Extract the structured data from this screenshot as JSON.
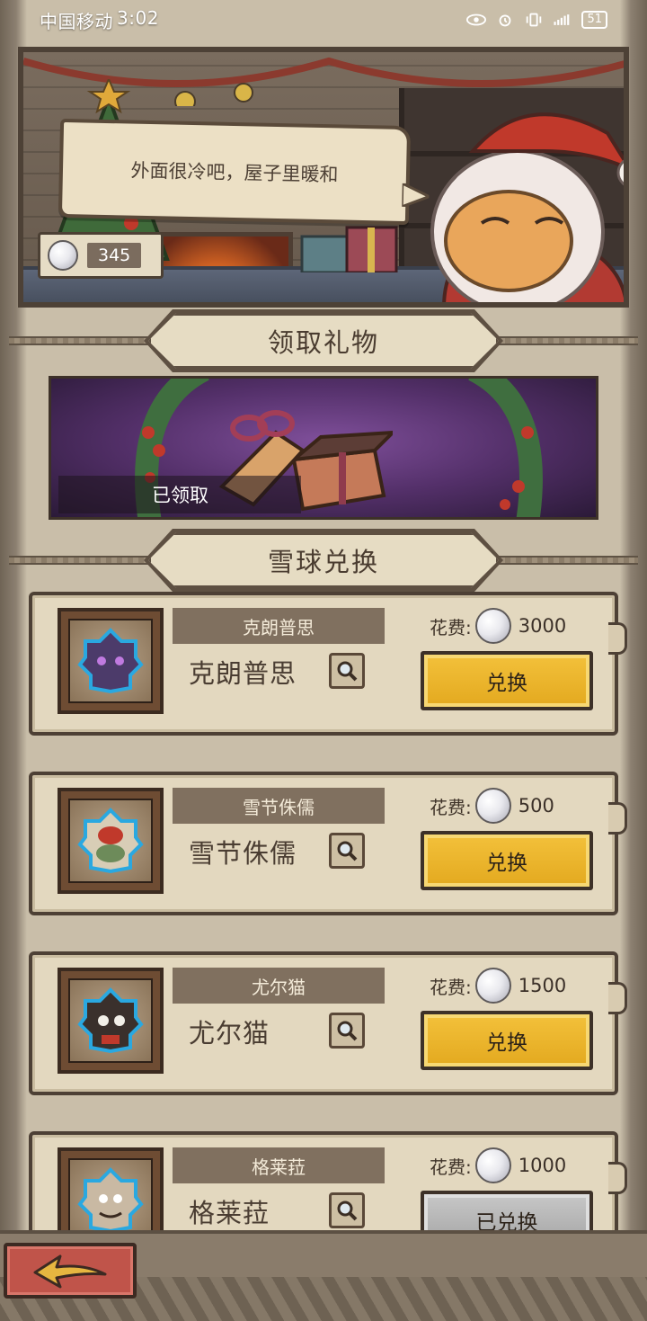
{
  "status_bar": {
    "carrier": "中国移动",
    "time": "3:02",
    "battery": "51"
  },
  "scene": {
    "speech": "外面很冷吧，屋子里暖和",
    "snowball_count": "345"
  },
  "sections": {
    "gift_title": "领取礼物",
    "gift_status": "已领取",
    "exchange_title": "雪球兑换"
  },
  "exchange": {
    "cost_label": "花费:",
    "items": [
      {
        "tag": "克朗普思",
        "name": "克朗普思",
        "cost": "3000",
        "button": "兑换",
        "state": "active",
        "theme": "purple"
      },
      {
        "tag": "雪节侏儒",
        "name": "雪节侏儒",
        "cost": "500",
        "button": "兑换",
        "state": "active",
        "theme": "green"
      },
      {
        "tag": "尤尔猫",
        "name": "尤尔猫",
        "cost": "1500",
        "button": "兑换",
        "state": "active",
        "theme": "black"
      },
      {
        "tag": "格莱菈",
        "name": "格莱菈",
        "cost": "1000",
        "button": "已兑换",
        "state": "done",
        "theme": "pale"
      }
    ]
  },
  "colors": {
    "accent_button": "#f3c13b",
    "done_button": "#b5b5b5",
    "back_button": "#c0544a",
    "parchment": "#e3d8bf"
  },
  "icons": [
    "eye-icon",
    "alarm-icon",
    "vibrate-icon",
    "signal-icon",
    "snowball-icon",
    "search-icon",
    "back-arrow-icon"
  ]
}
